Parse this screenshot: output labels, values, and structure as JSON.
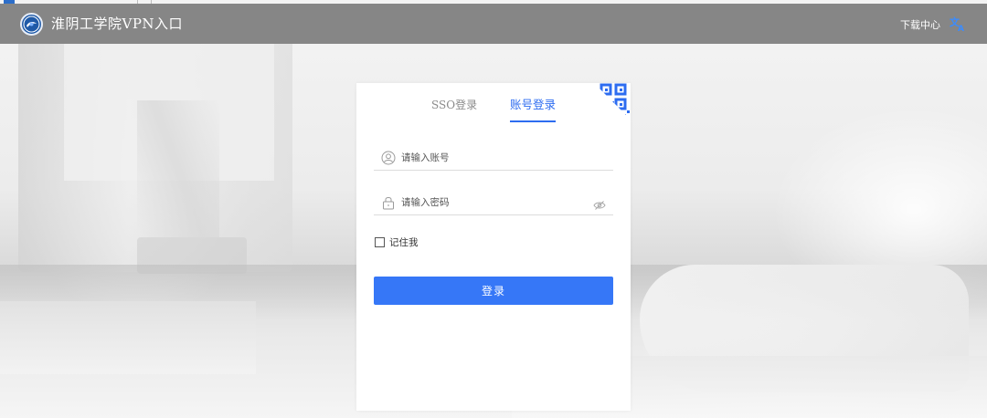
{
  "header": {
    "site_title": "淮阴工学院VPN入口",
    "download_label": "下载中心",
    "logo_icon": "school-emblem-icon",
    "language_icon": "translate-icon"
  },
  "login": {
    "tabs": [
      {
        "label": "SSO登录",
        "active": false
      },
      {
        "label": "账号登录",
        "active": true
      }
    ],
    "qr_icon": "qr-code-corner-icon",
    "account_placeholder": "请输入账号",
    "password_placeholder": "请输入密码",
    "remember_label": "记住我",
    "remember_checked": false,
    "submit_label": "登录"
  },
  "colors": {
    "accent": "#3677f7",
    "header_bg": "#6e6e6e",
    "card_bg": "#ffffff"
  }
}
